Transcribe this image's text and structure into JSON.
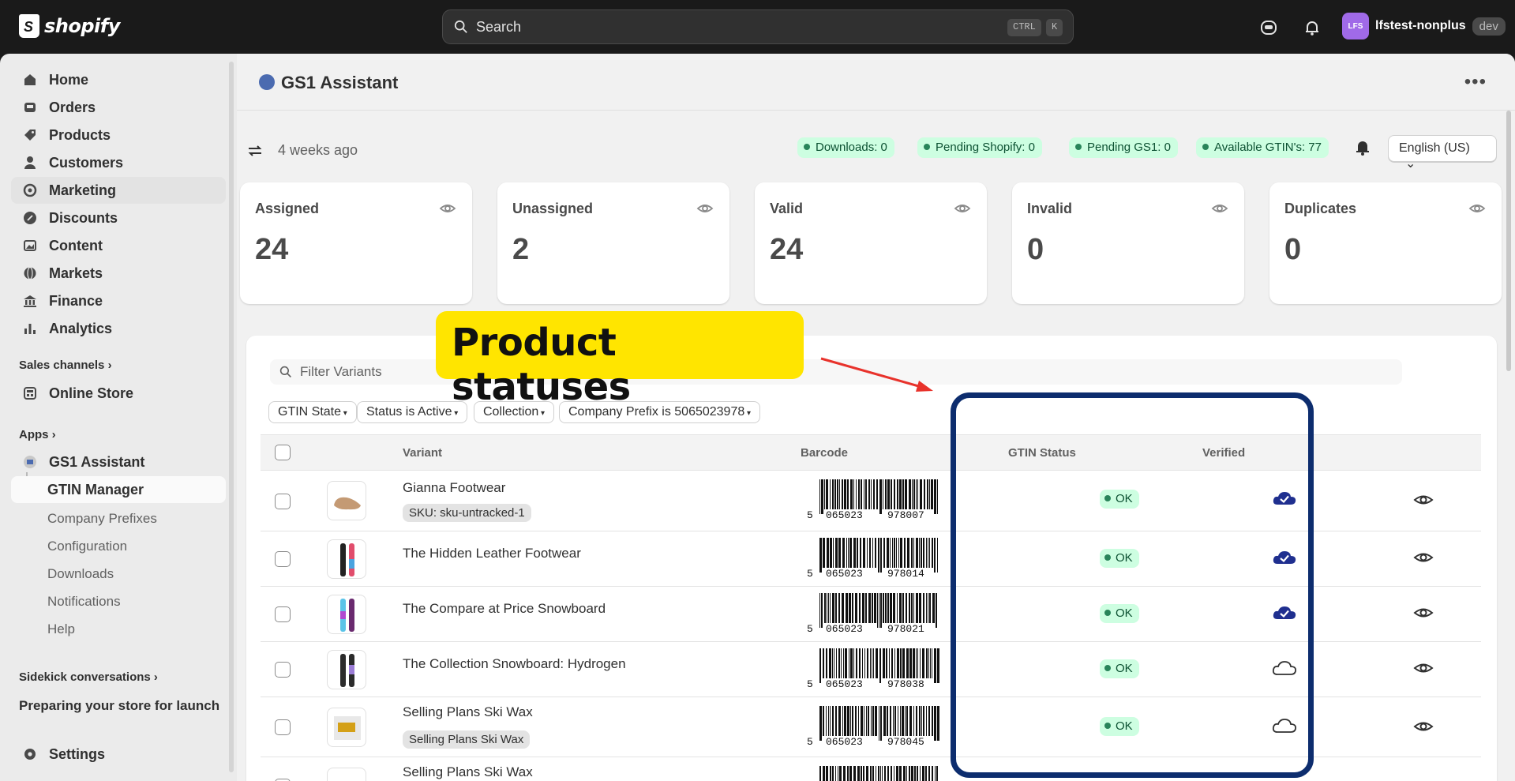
{
  "topbar": {
    "brand": "shopify",
    "search_placeholder": "Search",
    "kbd_ctrl": "CTRL",
    "kbd_k": "K",
    "user_initials": "LFS",
    "store_name": "lfstest-nonplus",
    "env_badge": "dev"
  },
  "sidebar": {
    "items": [
      {
        "label": "Home"
      },
      {
        "label": "Orders"
      },
      {
        "label": "Products"
      },
      {
        "label": "Customers"
      },
      {
        "label": "Marketing"
      },
      {
        "label": "Discounts"
      },
      {
        "label": "Content"
      },
      {
        "label": "Markets"
      },
      {
        "label": "Finance"
      },
      {
        "label": "Analytics"
      }
    ],
    "sales_channels": "Sales channels",
    "online_store": "Online Store",
    "apps": "Apps",
    "app_name": "GS1 Assistant",
    "gtin_manager": "GTIN Manager",
    "subitems": [
      "Company Prefixes",
      "Configuration",
      "Downloads",
      "Notifications",
      "Help"
    ],
    "sidekick": "Sidekick conversations",
    "sidekick_item": "Preparing your store for launch",
    "settings": "Settings"
  },
  "header": {
    "title": "GS1 Assistant",
    "last_sync": "4 weeks ago",
    "pills": [
      "Downloads: 0",
      "Pending Shopify: 0",
      "Pending GS1: 0",
      "Available GTIN's: 77"
    ],
    "language": "English (US)"
  },
  "stats": [
    {
      "label": "Assigned",
      "value": "24"
    },
    {
      "label": "Unassigned",
      "value": "2"
    },
    {
      "label": "Valid",
      "value": "24"
    },
    {
      "label": "Invalid",
      "value": "0"
    },
    {
      "label": "Duplicates",
      "value": "0"
    }
  ],
  "table": {
    "filter_placeholder": "Filter Variants",
    "chips": [
      "GTIN State",
      "Status is Active",
      "Collection",
      "Company Prefix is 5065023978"
    ],
    "headers": {
      "variant": "Variant",
      "barcode": "Barcode",
      "gtin_status": "GTIN Status",
      "verified": "Verified"
    },
    "rows": [
      {
        "name": "Gianna Footwear",
        "sku": "SKU: sku-untracked-1",
        "bc_first": "5",
        "bc_left": "065023",
        "bc_right": "978007",
        "status": "OK",
        "verified": true
      },
      {
        "name": "The Hidden Leather Footwear",
        "sku": "",
        "bc_first": "5",
        "bc_left": "065023",
        "bc_right": "978014",
        "status": "OK",
        "verified": true
      },
      {
        "name": "The Compare at Price Snowboard",
        "sku": "",
        "bc_first": "5",
        "bc_left": "065023",
        "bc_right": "978021",
        "status": "OK",
        "verified": true
      },
      {
        "name": "The Collection Snowboard: Hydrogen",
        "sku": "",
        "bc_first": "5",
        "bc_left": "065023",
        "bc_right": "978038",
        "status": "OK",
        "verified": false
      },
      {
        "name": "Selling Plans Ski Wax",
        "sku": "Selling Plans Ski Wax",
        "bc_first": "5",
        "bc_left": "065023",
        "bc_right": "978045",
        "status": "OK",
        "verified": false
      },
      {
        "name": "Selling Plans Ski Wax",
        "sku": "",
        "bc_first": "",
        "bc_left": "",
        "bc_right": "",
        "status": "",
        "verified": true
      }
    ]
  },
  "annotation": {
    "callout": "Product statuses"
  },
  "colors": {
    "accent_ok": "#cdfee1",
    "verified_cloud": "#1f2f8f",
    "highlight_border": "#0d2d6e",
    "callout_bg": "#ffe500"
  }
}
